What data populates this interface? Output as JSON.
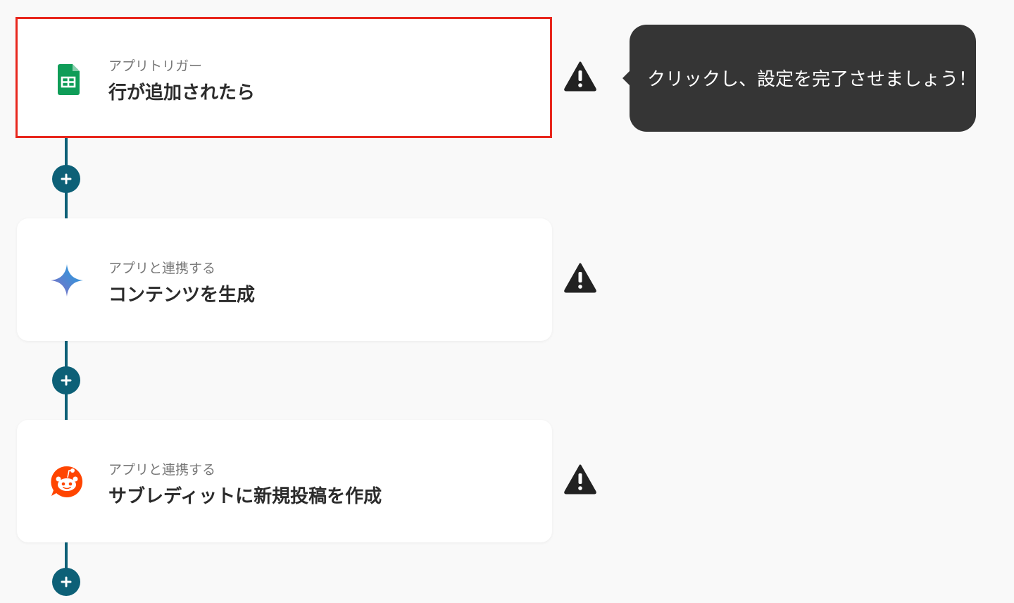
{
  "flow": {
    "steps": [
      {
        "label": "アプリトリガー",
        "title": "行が追加されたら",
        "icon": "google-sheets-icon",
        "selected": true
      },
      {
        "label": "アプリと連携する",
        "title": "コンテンツを生成",
        "icon": "gemini-icon",
        "selected": false
      },
      {
        "label": "アプリと連携する",
        "title": "サブレディットに新規投稿を作成",
        "icon": "reddit-icon",
        "selected": false
      }
    ],
    "add_icon": "plus-icon",
    "warning_icon": "warning-icon"
  },
  "tooltip": {
    "text": "クリックし、設定を完了させましょう！"
  },
  "colors": {
    "connector": "#0d6077",
    "selected_border": "#e8271d",
    "tooltip_bg": "#353535",
    "sheets_green": "#0f9d58",
    "reddit_orange": "#ff4500"
  }
}
